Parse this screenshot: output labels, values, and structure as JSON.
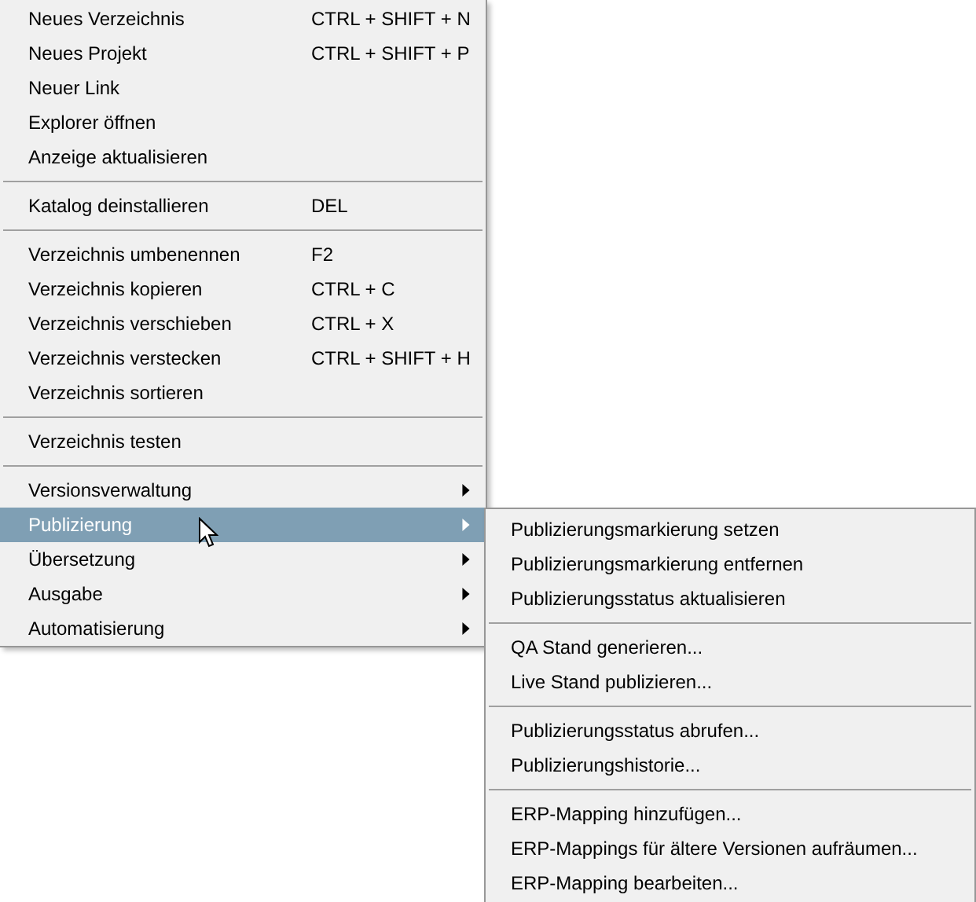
{
  "menu": {
    "items": [
      {
        "kind": "item",
        "label": "Neues Verzeichnis",
        "shortcut": "CTRL + SHIFT + N",
        "has_submenu": false,
        "selected": false
      },
      {
        "kind": "item",
        "label": "Neues Projekt",
        "shortcut": "CTRL + SHIFT + P",
        "has_submenu": false,
        "selected": false
      },
      {
        "kind": "item",
        "label": "Neuer Link",
        "has_submenu": false,
        "selected": false
      },
      {
        "kind": "item",
        "label": "Explorer öffnen",
        "has_submenu": false,
        "selected": false
      },
      {
        "kind": "item",
        "label": "Anzeige aktualisieren",
        "has_submenu": false,
        "selected": false
      },
      {
        "kind": "separator"
      },
      {
        "kind": "item",
        "label": "Katalog deinstallieren",
        "shortcut": "DEL",
        "has_submenu": false,
        "selected": false
      },
      {
        "kind": "separator"
      },
      {
        "kind": "item",
        "label": "Verzeichnis umbenennen",
        "shortcut": "F2",
        "has_submenu": false,
        "selected": false
      },
      {
        "kind": "item",
        "label": "Verzeichnis kopieren",
        "shortcut": "CTRL + C",
        "has_submenu": false,
        "selected": false
      },
      {
        "kind": "item",
        "label": "Verzeichnis verschieben",
        "shortcut": "CTRL + X",
        "has_submenu": false,
        "selected": false
      },
      {
        "kind": "item",
        "label": "Verzeichnis verstecken",
        "shortcut": "CTRL + SHIFT + H",
        "has_submenu": false,
        "selected": false
      },
      {
        "kind": "item",
        "label": "Verzeichnis sortieren",
        "has_submenu": false,
        "selected": false
      },
      {
        "kind": "separator"
      },
      {
        "kind": "item",
        "label": "Verzeichnis testen",
        "has_submenu": false,
        "selected": false
      },
      {
        "kind": "separator"
      },
      {
        "kind": "item",
        "label": "Versionsverwaltung",
        "has_submenu": true,
        "selected": false
      },
      {
        "kind": "item",
        "label": "Publizierung",
        "has_submenu": true,
        "selected": true
      },
      {
        "kind": "item",
        "label": "Übersetzung",
        "has_submenu": true,
        "selected": false
      },
      {
        "kind": "item",
        "label": "Ausgabe",
        "has_submenu": true,
        "selected": false
      },
      {
        "kind": "item",
        "label": "Automatisierung",
        "has_submenu": true,
        "selected": false
      }
    ]
  },
  "submenu": {
    "items": [
      {
        "kind": "item",
        "label": "Publizierungsmarkierung setzen"
      },
      {
        "kind": "item",
        "label": "Publizierungsmarkierung entfernen"
      },
      {
        "kind": "item",
        "label": "Publizierungsstatus aktualisieren"
      },
      {
        "kind": "separator"
      },
      {
        "kind": "item",
        "label": "QA Stand generieren..."
      },
      {
        "kind": "item",
        "label": "Live Stand publizieren..."
      },
      {
        "kind": "separator"
      },
      {
        "kind": "item",
        "label": "Publizierungsstatus abrufen..."
      },
      {
        "kind": "item",
        "label": "Publizierungshistorie..."
      },
      {
        "kind": "separator"
      },
      {
        "kind": "item",
        "label": "ERP-Mapping hinzufügen..."
      },
      {
        "kind": "item",
        "label": "ERP-Mappings für ältere Versionen aufräumen..."
      },
      {
        "kind": "item",
        "label": "ERP-Mapping bearbeiten..."
      }
    ]
  }
}
